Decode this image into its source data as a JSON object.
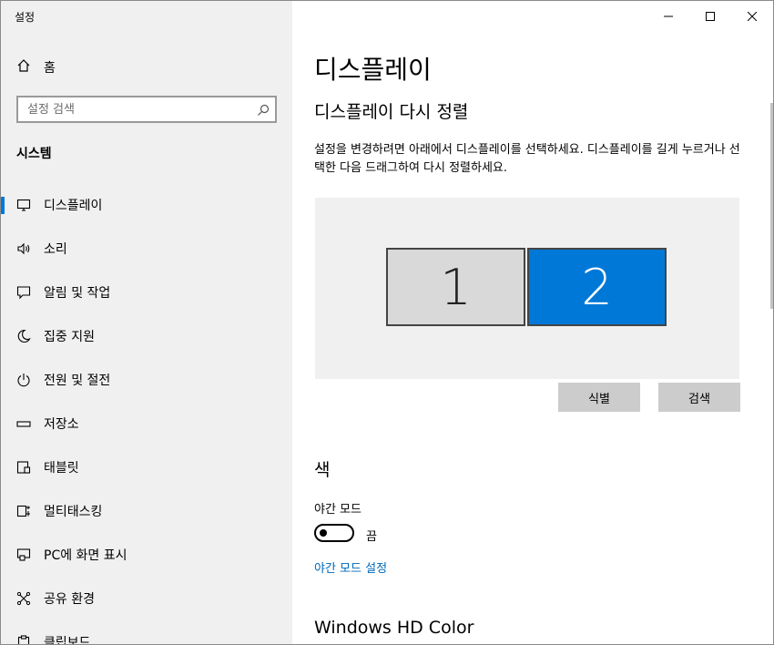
{
  "window": {
    "title": "설정"
  },
  "sidebar": {
    "home_label": "홈",
    "search_placeholder": "설정 검색",
    "section_title": "시스템",
    "items": [
      {
        "label": "디스플레이",
        "icon": "monitor-icon",
        "active": true
      },
      {
        "label": "소리",
        "icon": "speaker-icon"
      },
      {
        "label": "알림 및 작업",
        "icon": "notification-icon"
      },
      {
        "label": "집중 지원",
        "icon": "moon-icon"
      },
      {
        "label": "전원 및 절전",
        "icon": "power-icon"
      },
      {
        "label": "저장소",
        "icon": "storage-icon"
      },
      {
        "label": "태블릿",
        "icon": "tablet-icon"
      },
      {
        "label": "멀티태스킹",
        "icon": "multitasking-icon"
      },
      {
        "label": "PC에 화면 표시",
        "icon": "project-icon"
      },
      {
        "label": "공유 환경",
        "icon": "shared-experiences-icon"
      },
      {
        "label": "클립보드",
        "icon": "clipboard-icon"
      }
    ]
  },
  "main": {
    "title": "디스플레이",
    "rearrange": {
      "heading": "디스플레이 다시 정렬",
      "description": "설정을 변경하려면 아래에서 디스플레이를 선택하세요. 디스플레이를 길게 누르거나 선택한 다음 드래그하여 다시 정렬하세요.",
      "monitors": [
        {
          "label": "1",
          "selected": false
        },
        {
          "label": "2",
          "selected": true
        }
      ],
      "identify_label": "식별",
      "detect_label": "검색"
    },
    "color": {
      "heading": "색",
      "night_light_label": "야간 모드",
      "toggle_state": "끔",
      "settings_link": "야간 모드 설정"
    },
    "hd_color_heading": "Windows HD Color"
  },
  "colors": {
    "accent": "#0078d7",
    "link": "#0067b8",
    "sidebar_bg": "#f0f0f0"
  }
}
